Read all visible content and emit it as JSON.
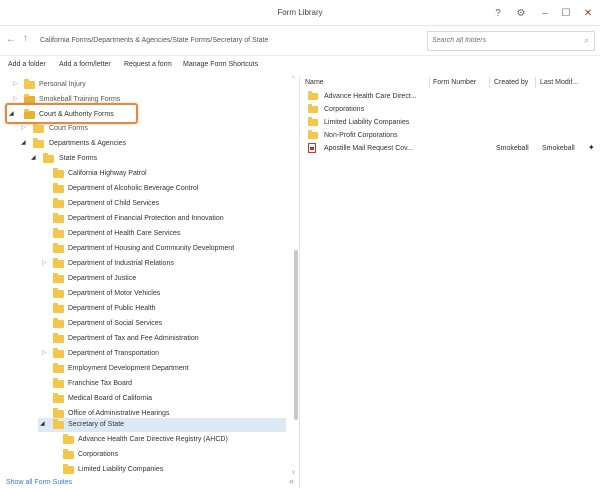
{
  "window": {
    "title": "Form Library",
    "help_glyph": "?",
    "gear_glyph": "⚙",
    "min_glyph": "–",
    "max_glyph": "☐",
    "close_glyph": "✕"
  },
  "address": {
    "back_glyph": "←",
    "up_glyph": "↑",
    "path": "California Forms/Departments & Agencies/State Forms/Secretary of State",
    "search_placeholder": "Search all folders",
    "search_glyph": "⌕"
  },
  "toolbar": {
    "add_folder": "Add a folder",
    "add_form": "Add a form/letter",
    "request_form": "Request a form",
    "manage_shortcuts": "Manage Form Shortcuts"
  },
  "tree": [
    {
      "label": "Personal Injury",
      "arrow": "▷"
    },
    {
      "label": "Smokeball Training Forms",
      "arrow": "▷"
    },
    {
      "label": "Court & Authority Forms",
      "arrow": "◢"
    },
    {
      "label": "Court Forms",
      "arrow": "▷"
    },
    {
      "label": "Departments & Agencies",
      "arrow": "◢"
    },
    {
      "label": "State Forms",
      "arrow": "◢"
    },
    {
      "label": "California Highway Patrol",
      "arrow": ""
    },
    {
      "label": "Department of Alcoholic Beverage Control",
      "arrow": ""
    },
    {
      "label": "Department of Child Services",
      "arrow": ""
    },
    {
      "label": "Department of Financial Protection and Innovation",
      "arrow": ""
    },
    {
      "label": "Department of Health Care Services",
      "arrow": ""
    },
    {
      "label": "Department of Housing and Community Development",
      "arrow": ""
    },
    {
      "label": "Department of Industrial Relations",
      "arrow": "▷"
    },
    {
      "label": "Department of Justice",
      "arrow": ""
    },
    {
      "label": "Department of Motor Vehicles",
      "arrow": ""
    },
    {
      "label": "Department of Public Health",
      "arrow": ""
    },
    {
      "label": "Department of Social Services",
      "arrow": ""
    },
    {
      "label": "Department of Tax and Fee Administration",
      "arrow": ""
    },
    {
      "label": "Department of Transportation",
      "arrow": "▷"
    },
    {
      "label": "Employment Development Department",
      "arrow": ""
    },
    {
      "label": "Franchise Tax Board",
      "arrow": ""
    },
    {
      "label": "Medical Board of California",
      "arrow": ""
    },
    {
      "label": "Office of Administrative Hearings",
      "arrow": ""
    },
    {
      "label": "Secretary of State",
      "arrow": "◢"
    },
    {
      "label": "Advance Health Care Directive Registry (AHCD)",
      "arrow": ""
    },
    {
      "label": "Corporations",
      "arrow": ""
    },
    {
      "label": "Limited Liability Companies",
      "arrow": ""
    }
  ],
  "footer": {
    "show_all": "Show all Form Suites",
    "collapse_glyph": "«"
  },
  "scroll": {
    "up_glyph": "^",
    "down_glyph": "v"
  },
  "list": {
    "columns": [
      "Name",
      "Form Number",
      "Created by",
      "Last Modif..."
    ],
    "rows": [
      {
        "name": "Advance Health Care Direct...",
        "form_number": "",
        "created_by": "",
        "last_modified": ""
      },
      {
        "name": "Corporations",
        "form_number": "",
        "created_by": "",
        "last_modified": ""
      },
      {
        "name": "Limited Liability Companies",
        "form_number": "",
        "created_by": "",
        "last_modified": ""
      },
      {
        "name": "Non-Profit Corporations",
        "form_number": "",
        "created_by": "",
        "last_modified": ""
      },
      {
        "name": "Apostille Mail Request Cov...",
        "form_number": "",
        "created_by": "Smokeball",
        "last_modified": "Smokeball",
        "pin_glyph": "✦"
      }
    ]
  },
  "colors": {
    "accent_highlight": "#e08a44",
    "folder": "#f4c64c",
    "selected_row": "#dde9f5",
    "link": "#3a7bd5",
    "close": "#c4302b"
  }
}
